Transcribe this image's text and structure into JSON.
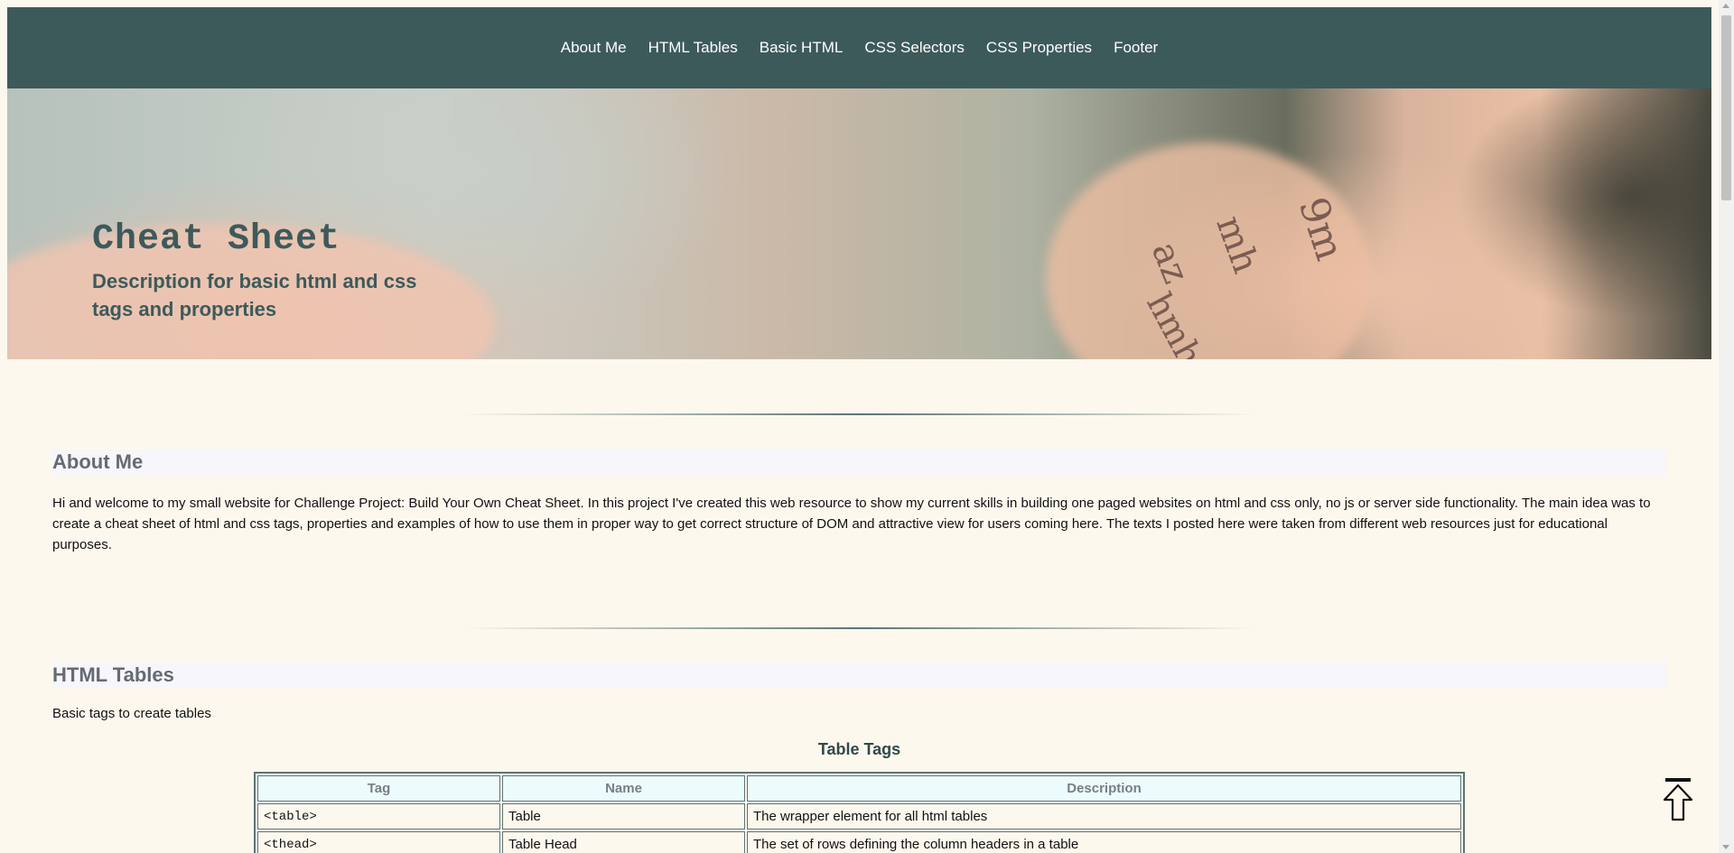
{
  "nav": {
    "items": [
      "About Me",
      "HTML Tables",
      "Basic HTML",
      "CSS Selectors",
      "CSS Properties",
      "Footer"
    ]
  },
  "hero": {
    "title": "Cheat Sheet",
    "subtitle": "Description for basic html and css tags and properties"
  },
  "about": {
    "heading": "About Me",
    "text": "Hi and welcome to my small website for Challenge Project: Build Your Own Cheat Sheet. In this project I've created this web resource to show my current skills in building one paged websites on html and css only, no js or server side functionality. The main idea was to create a cheat sheet of html and css tags, properties and examples of how to use them in proper way to get correct structure of DOM and attractive view for users coming here. The texts I posted here were taken from different web resources just for educational purposes."
  },
  "tables_section": {
    "heading": "HTML Tables",
    "intro": "Basic tags to create tables",
    "table_title": "Table Tags",
    "columns": [
      "Tag",
      "Name",
      "Description"
    ],
    "rows": [
      [
        "<table>",
        "Table",
        "The wrapper element for all html tables"
      ],
      [
        "<thead>",
        "Table Head",
        "The set of rows defining the column headers in a table"
      ]
    ]
  },
  "icons": {
    "back_to_top": "arrow-up-to-top-icon"
  }
}
